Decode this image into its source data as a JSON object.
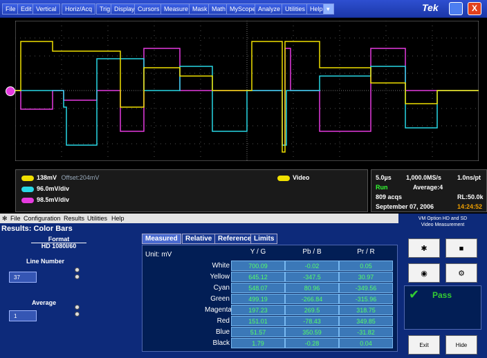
{
  "menubar": {
    "items": [
      "File",
      "Edit",
      "Vertical",
      "Horiz/Acq",
      "Trig",
      "Display",
      "Cursors",
      "Measure",
      "Mask",
      "Math",
      "MyScope",
      "Analyze",
      "Utilities",
      "Help"
    ],
    "brand": "Tek"
  },
  "scope": {
    "ch1": {
      "tag": "C1",
      "scale": "138mV",
      "offset": "Offset:204mV",
      "color": "#f0e000"
    },
    "ch2": {
      "tag": "C2",
      "scale": "96.0mV/div",
      "color": "#29d7e6"
    },
    "ch3": {
      "tag": "C3",
      "scale": "98.5mV/div",
      "color": "#e63be0"
    },
    "trigger": {
      "tag": "C1",
      "label": "Video"
    },
    "horiz": {
      "scale": "5.0µs",
      "rate": "1,000.0MS/s",
      "res": "1.0ns/pt",
      "state": "Run",
      "avg": "Average:4",
      "acqs": "809 acqs",
      "rl": "RL:50.0k",
      "date": "September 07, 2006",
      "time": "14:24:52"
    }
  },
  "app": {
    "menu": [
      "File",
      "Configuration",
      "Results",
      "Utilities",
      "Help"
    ],
    "title": "Results: Color Bars",
    "format_label": "Format",
    "format_value": "HD 1080I/60",
    "line_label": "Line Number",
    "line_value": "37",
    "avg_label": "Average",
    "avg_value": "1",
    "tabs": [
      "Measured",
      "Relative",
      "Reference",
      "Limits"
    ],
    "unit": "Unit: mV",
    "cols": [
      "Y / G",
      "Pb / B",
      "Pr / R"
    ],
    "rows": [
      {
        "name": "White",
        "v": [
          "700.09",
          "-0.02",
          "0.05"
        ]
      },
      {
        "name": "Yellow",
        "v": [
          "645.12",
          "-347.5",
          "30.97"
        ]
      },
      {
        "name": "Cyan",
        "v": [
          "548.07",
          "80.96",
          "-349.56"
        ]
      },
      {
        "name": "Green",
        "v": [
          "499.19",
          "-266.84",
          "-315.96"
        ]
      },
      {
        "name": "Magenta",
        "v": [
          "197.23",
          "269.5",
          "318.75"
        ]
      },
      {
        "name": "Red",
        "v": [
          "151.01",
          "-78.43",
          "349.85"
        ]
      },
      {
        "name": "Blue",
        "v": [
          "51.57",
          "350.59",
          "-31.82"
        ]
      },
      {
        "name": "Black",
        "v": [
          "1.79",
          "-0.28",
          "0.04"
        ]
      }
    ]
  },
  "vm": {
    "title1": "VM Option HD and SD",
    "title2": "Video Measurement",
    "status": "Pass",
    "exit": "Exit",
    "hide": "Hide"
  }
}
